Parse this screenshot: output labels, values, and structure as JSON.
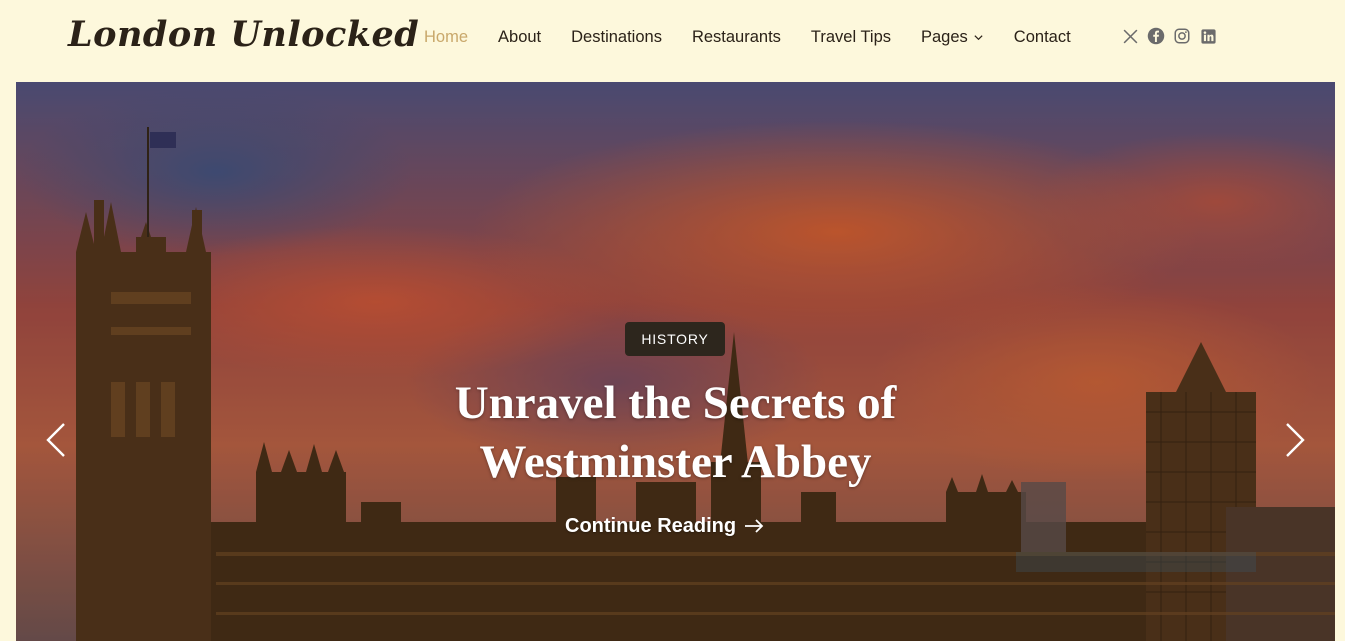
{
  "site": {
    "logo": "London Unlocked"
  },
  "nav": {
    "items": [
      {
        "label": "Home",
        "active": true
      },
      {
        "label": "About"
      },
      {
        "label": "Destinations"
      },
      {
        "label": "Restaurants"
      },
      {
        "label": "Travel Tips"
      },
      {
        "label": "Pages",
        "has_dropdown": true
      },
      {
        "label": "Contact"
      }
    ]
  },
  "social": [
    {
      "icon": "x-twitter-icon"
    },
    {
      "icon": "facebook-icon"
    },
    {
      "icon": "instagram-icon"
    },
    {
      "icon": "linkedin-icon"
    }
  ],
  "hero": {
    "badge": "HISTORY",
    "title_line1": "Unravel the Secrets of",
    "title_line2": "Westminster Abbey",
    "cta": "Continue Reading"
  },
  "colors": {
    "background": "#fdf8dc",
    "text": "#2b2218",
    "active_nav": "#c9a86b",
    "badge_bg": "#2d261d"
  }
}
